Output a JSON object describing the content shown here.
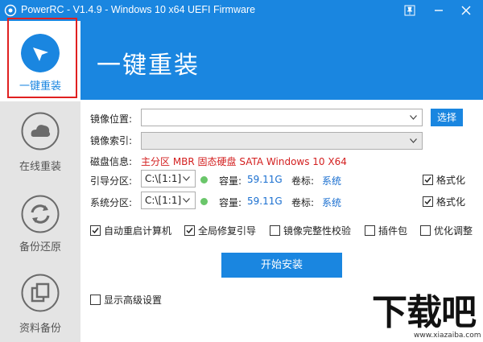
{
  "window": {
    "title": "PowerRC - V1.4.9 - Windows 10 x64 UEFI Firmware",
    "icons": [
      "app-icon",
      "pin-icon",
      "minimize-icon",
      "close-icon"
    ]
  },
  "sidebar": {
    "items": [
      {
        "label": "一键重装",
        "icon": "cursor-arrow-icon",
        "active": true
      },
      {
        "label": "在线重装",
        "icon": "cloud-icon",
        "active": false
      },
      {
        "label": "备份还原",
        "icon": "refresh-icon",
        "active": false
      },
      {
        "label": "资料备份",
        "icon": "copy-icon",
        "active": false
      }
    ]
  },
  "banner": {
    "title": "一键重装"
  },
  "form": {
    "image_location_label": "镜像位置:",
    "image_location_value": "",
    "select_button": "选择",
    "image_index_label": "镜像索引:",
    "image_index_value": "",
    "disk_info_label": "磁盘信息:",
    "disk_info_value": "主分区 MBR 固态硬盘 SATA Windows 10 X64",
    "boot_partition": {
      "label": "引导分区:",
      "value": "C:\\[1:1]",
      "capacity_label": "容量:",
      "capacity": "59.11G",
      "volume_label": "卷标:",
      "volume": "系统",
      "format_label": "格式化",
      "format_checked": true
    },
    "system_partition": {
      "label": "系统分区:",
      "value": "C:\\[1:1]",
      "capacity_label": "容量:",
      "capacity": "59.11G",
      "volume_label": "卷标:",
      "volume": "系统",
      "format_label": "格式化",
      "format_checked": true
    },
    "options": [
      {
        "label": "自动重启计算机",
        "checked": true
      },
      {
        "label": "全局修复引导",
        "checked": true
      },
      {
        "label": "镜像完整性校验",
        "checked": false
      },
      {
        "label": "插件包",
        "checked": false
      },
      {
        "label": "优化调整",
        "checked": false
      }
    ],
    "install_button": "开始安装",
    "advanced_label": "显示高级设置",
    "advanced_checked": false
  },
  "watermark": {
    "big": "下载吧",
    "small": "www.xiazaiba.com"
  },
  "colors": {
    "accent": "#1a86e0",
    "sidebar_bg": "#e4e4e4",
    "highlight_frame": "#e02020",
    "disk_info": "#d31f1f",
    "link_blue": "#1a6fd0",
    "status_dot": "#6ac66a"
  }
}
